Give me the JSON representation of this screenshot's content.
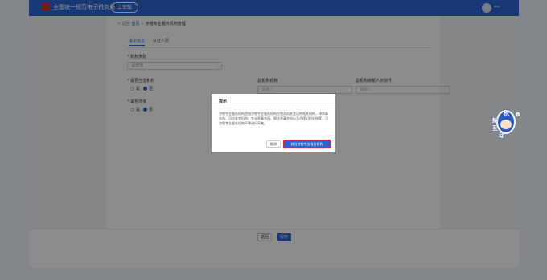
{
  "header": {
    "app_title": "全国统一规范电子税务局",
    "badge": "上安徽",
    "user_name": "***"
  },
  "breadcrumb": {
    "back": "< 返回",
    "home": "首页",
    "separator": ">",
    "current": "涉税专业服务机构管理"
  },
  "tabs": [
    {
      "label": "基本信息",
      "active": true
    },
    {
      "label": "从业人员",
      "active": false
    }
  ],
  "form": {
    "org_type_label": "机构类别",
    "org_type_value": "请选择",
    "is_branch_label": "是否分支机构",
    "radio_yes": "是",
    "radio_no": "否",
    "parent_name_label": "总机构名称",
    "parent_name_placeholder": "请输入",
    "parent_id_label": "总机构纳税人识别号",
    "parent_id_placeholder": "请输入",
    "is_foreign_label": "是否外资",
    "radio_yes2": "是",
    "radio_no2": "否"
  },
  "footer": {
    "back_label": "返回",
    "save_label": "保存"
  },
  "dialog": {
    "title": "提示",
    "body": "涉税专业服务机构是指涉税专业服务机构在税务机关登记的相关机构，律师事务所、司法鉴定机构、会计师事务所、税务师事务所以及代理记账机构等，可涉税专业服务机构不需进行采集。",
    "cancel_label": "取消",
    "confirm_label": "前往涉税专业服务机构"
  },
  "mascot": {
    "chars": [
      "纳",
      "税",
      "互",
      "动"
    ]
  }
}
